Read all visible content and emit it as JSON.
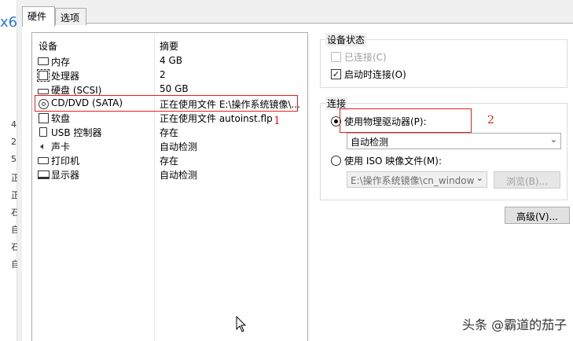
{
  "background_window": {
    "title_fragment": "x6",
    "chars": [
      "4",
      "2",
      "5",
      "正",
      "正",
      "石",
      "自",
      "石",
      "自"
    ]
  },
  "tabs": [
    {
      "label": "硬件",
      "active": true
    },
    {
      "label": "选项",
      "active": false
    }
  ],
  "device_list": {
    "headers": {
      "device": "设备",
      "summary": "摘要"
    },
    "rows": [
      {
        "icon": "memory-icon",
        "device": "内存",
        "summary": "4 GB"
      },
      {
        "icon": "processor-icon",
        "device": "处理器",
        "summary": "2"
      },
      {
        "icon": "hard-disk-icon",
        "device": "硬盘 (SCSI)",
        "summary": "50 GB"
      },
      {
        "icon": "cd-dvd-icon",
        "device": "CD/DVD (SATA)",
        "summary": "正在使用文件 E:\\操作系统镜像\\..."
      },
      {
        "icon": "floppy-icon",
        "device": "软盘",
        "summary": "正在使用文件 autoinst.flp"
      },
      {
        "icon": "usb-icon",
        "device": "USB 控制器",
        "summary": "存在"
      },
      {
        "icon": "sound-card-icon",
        "device": "声卡",
        "summary": "自动检测"
      },
      {
        "icon": "printer-icon",
        "device": "打印机",
        "summary": "存在"
      },
      {
        "icon": "display-icon",
        "device": "显示器",
        "summary": "自动检测"
      }
    ]
  },
  "annotations": {
    "num1": "1",
    "num2": "2",
    "color": "#e02020"
  },
  "device_status": {
    "title": "设备状态",
    "connected_label": "已连接(C)",
    "connected_checked": false,
    "connect_at_power_on_label": "启动时连接(O)",
    "connect_at_power_on_checked": true
  },
  "connection": {
    "title": "连接",
    "use_physical_label": "使用物理驱动器(P):",
    "use_physical_selected": true,
    "physical_drive_value": "自动检测",
    "use_iso_label": "使用 ISO 映像文件(M):",
    "use_iso_selected": false,
    "iso_path_value": "E:\\操作系统镜像\\cn_window",
    "browse_label": "浏览(B)..."
  },
  "advanced_label": "高级(V)...",
  "watermark": "头条 @霸道的茄子"
}
